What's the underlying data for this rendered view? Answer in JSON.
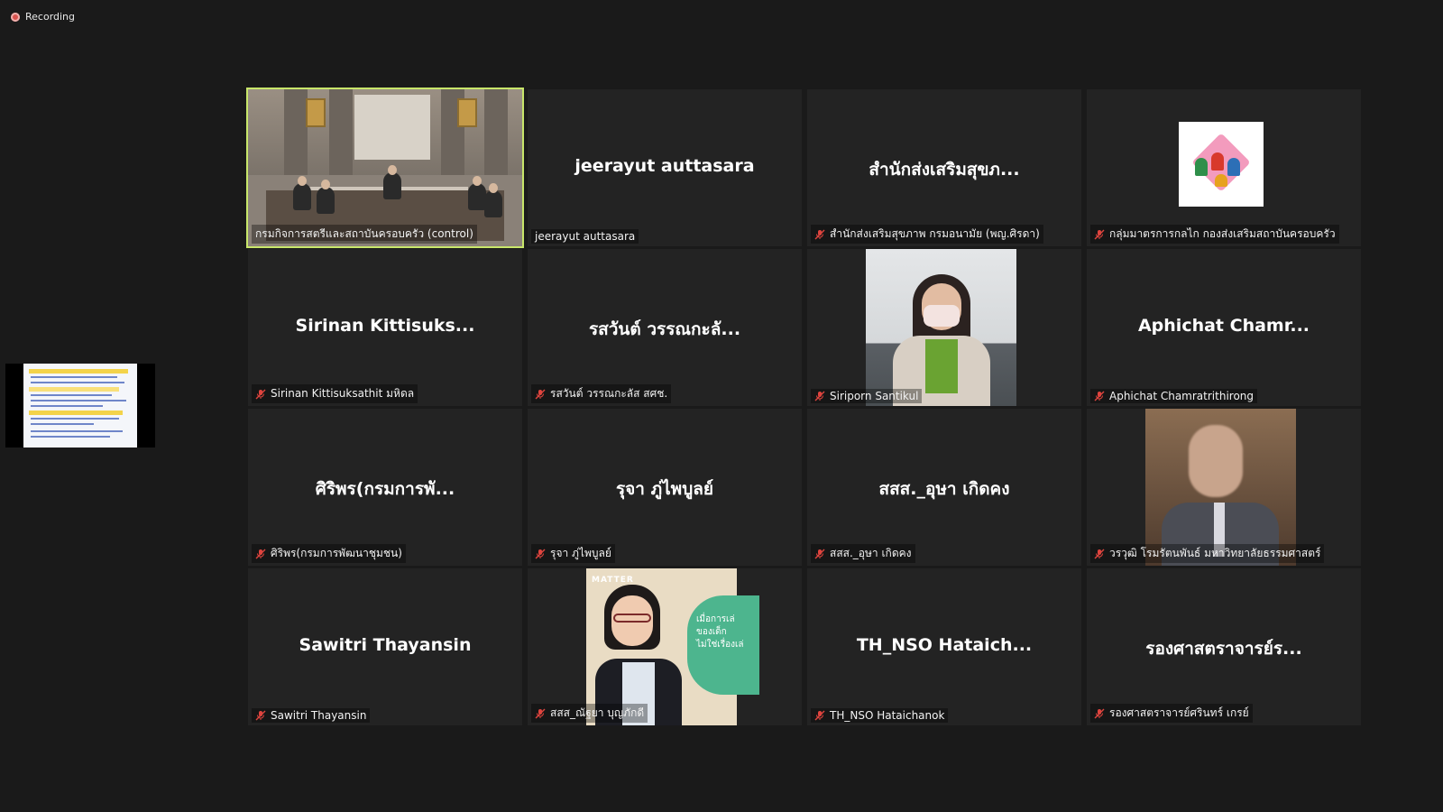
{
  "recording": {
    "label": "Recording"
  },
  "colors": {
    "active_border": "#c8e66a",
    "tile_bg": "#232323",
    "bg": "#1a1a1a",
    "mic_muted": "#e0443e"
  },
  "participants": [
    {
      "label": "กรมกิจการสตรีและสถาบันครอบครัว  (control)",
      "big_name": "",
      "muted": false,
      "active": true,
      "media": "conference-room"
    },
    {
      "label": "jeerayut auttasara",
      "big_name": "jeerayut auttasara",
      "muted": false,
      "active": false,
      "media": "none"
    },
    {
      "label": "สำนักส่งเสริมสุขภาพ กรมอนามัย (พญ.ศิรดา)",
      "big_name": "สำนักส่งเสริมสุขภ...",
      "muted": true,
      "active": false,
      "media": "none"
    },
    {
      "label": "กลุ่มมาตรการกลไก กองส่งเสริมสถาบันครอบครัว",
      "big_name": "",
      "muted": true,
      "active": false,
      "media": "logo"
    },
    {
      "label": "Sirinan Kittisuksathit มหิดล",
      "big_name": "Sirinan  Kittisuks...",
      "muted": true,
      "active": false,
      "media": "none"
    },
    {
      "label": "รสวันต์ วรรณกะลัส สศช.",
      "big_name": "รสวันต์ วรรณกะลั...",
      "muted": true,
      "active": false,
      "media": "none"
    },
    {
      "label": "Siriporn Santikul",
      "big_name": "",
      "muted": true,
      "active": false,
      "media": "portrait-woman"
    },
    {
      "label": "Aphichat Chamratrithirong",
      "big_name": "Aphichat  Chamr...",
      "muted": true,
      "active": false,
      "media": "none"
    },
    {
      "label": "ศิริพร(กรมการพัฒนาชุมชน)",
      "big_name": "ศิริพร(กรมการพั...",
      "muted": true,
      "active": false,
      "media": "none"
    },
    {
      "label": "รุจา ภู่ไพบูลย์",
      "big_name": "รุจา ภู่ไพบูลย์",
      "muted": true,
      "active": false,
      "media": "none"
    },
    {
      "label": "สสส._อุษา เกิดคง",
      "big_name": "สสส._อุษา เกิดคง",
      "muted": true,
      "active": false,
      "media": "none"
    },
    {
      "label": "วรวุฒิ โรมรัตนพันธ์ มหาวิทยาลัยธรรมศาสตร์",
      "big_name": "",
      "muted": true,
      "active": false,
      "media": "portrait-man"
    },
    {
      "label": "Sawitri Thayansin",
      "big_name": "Sawitri Thayansin",
      "muted": true,
      "active": false,
      "media": "none"
    },
    {
      "label": "สสส_ณัฐยา บุญภักดี",
      "big_name": "",
      "muted": true,
      "active": false,
      "media": "portrait-poster"
    },
    {
      "label": "TH_NSO Hataichanok",
      "big_name": "TH_NSO  Hataich...",
      "muted": true,
      "active": false,
      "media": "none"
    },
    {
      "label": "รองศาสตราจารย์ศรินทร์ เกรย์",
      "big_name": "รองศาสตราจารย์ร...",
      "muted": true,
      "active": false,
      "media": "none"
    }
  ],
  "poster": {
    "tag": "MATTER",
    "lines": [
      "เมื่อการเล่",
      "ของเด็ก",
      "ไม่ใช่เรื่องเล่"
    ]
  }
}
